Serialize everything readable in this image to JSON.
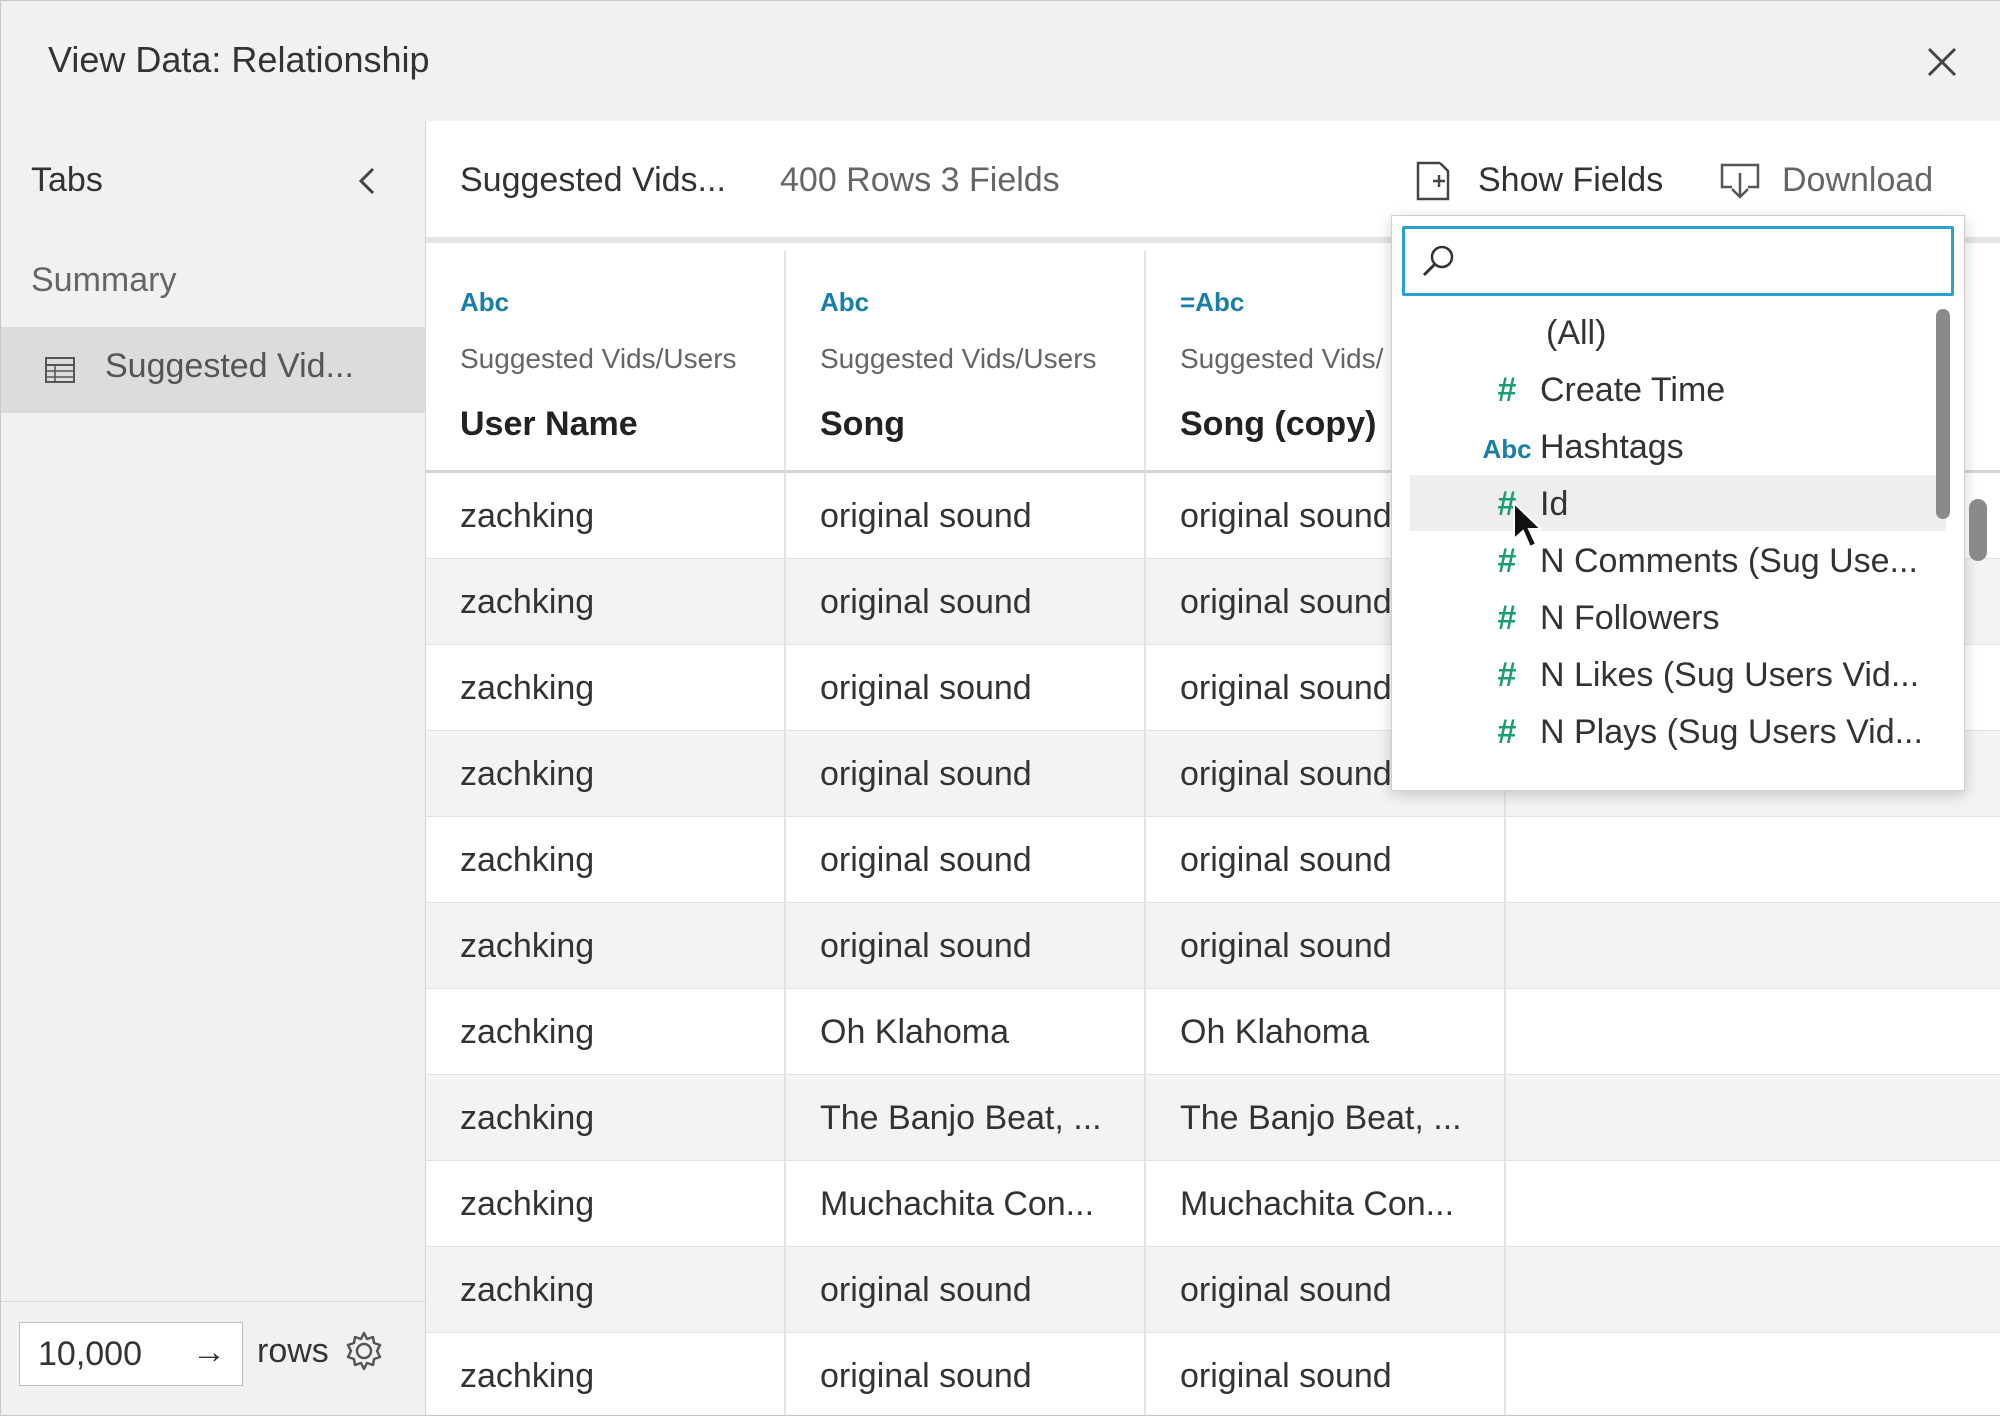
{
  "window": {
    "title": "View Data: Relationship"
  },
  "sidebar": {
    "tabs_label": "Tabs",
    "summary_label": "Summary",
    "active_item": "Suggested Vid...",
    "rows_value": "10,000",
    "rows_label": "rows"
  },
  "toolbar": {
    "table_name": "Suggested Vids...",
    "counts": "400 Rows 3 Fields",
    "show_fields_label": "Show Fields",
    "download_label": "Download"
  },
  "table": {
    "columns": [
      {
        "type": "Abc",
        "source": "Suggested Vids/Users",
        "name": "User Name"
      },
      {
        "type": "Abc",
        "source": "Suggested Vids/Users",
        "name": "Song"
      },
      {
        "type": "=Abc",
        "source": "Suggested Vids/",
        "name": "Song (copy)"
      }
    ],
    "rows": [
      [
        "zachking",
        "original sound",
        "original sound"
      ],
      [
        "zachking",
        "original sound",
        "original sound"
      ],
      [
        "zachking",
        "original sound",
        "original sound"
      ],
      [
        "zachking",
        "original sound",
        "original sound"
      ],
      [
        "zachking",
        "original sound",
        "original sound"
      ],
      [
        "zachking",
        "original sound",
        "original sound"
      ],
      [
        "zachking",
        "Oh Klahoma",
        "Oh Klahoma"
      ],
      [
        "zachking",
        "The Banjo Beat, ...",
        "The Banjo Beat, ..."
      ],
      [
        "zachking",
        "Muchachita Con...",
        "Muchachita Con..."
      ],
      [
        "zachking",
        "original sound",
        "original sound"
      ],
      [
        "zachking",
        "original sound",
        "original sound"
      ]
    ]
  },
  "field_picker": {
    "search_placeholder": "",
    "items": [
      {
        "icon": "",
        "label": "(All)"
      },
      {
        "icon": "#",
        "label": "Create Time"
      },
      {
        "icon": "Abc",
        "label": "Hashtags"
      },
      {
        "icon": "#",
        "label": "Id"
      },
      {
        "icon": "#",
        "label": "N Comments (Sug Use..."
      },
      {
        "icon": "#",
        "label": "N Followers"
      },
      {
        "icon": "#",
        "label": "N Likes (Sug Users Vid..."
      },
      {
        "icon": "#",
        "label": "N Plays (Sug Users Vid..."
      }
    ]
  },
  "colors": {
    "accent": "#2a9fd6",
    "number_icon": "#1a9f6e",
    "string_icon": "#1a7fa8"
  }
}
